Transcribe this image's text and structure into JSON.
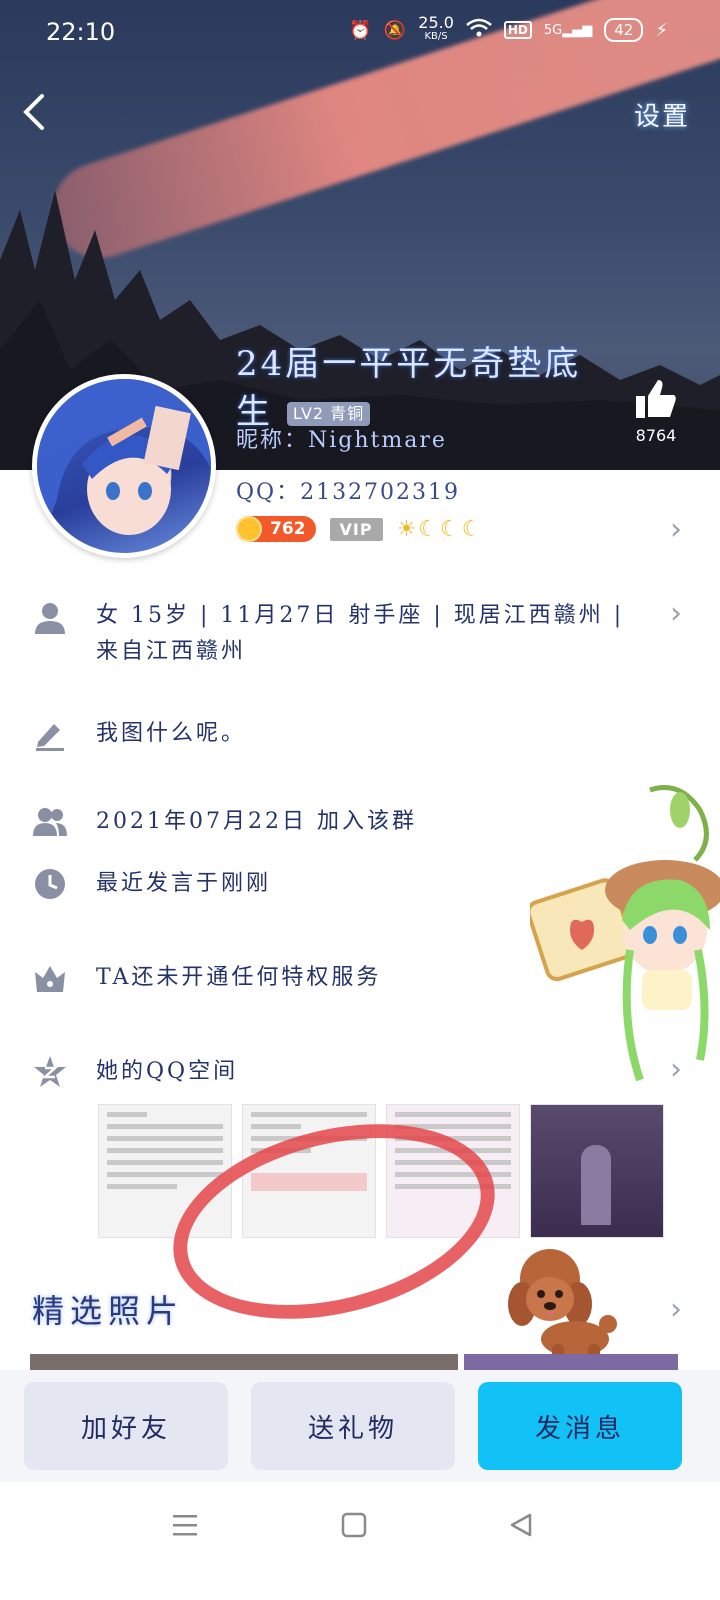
{
  "status_bar": {
    "time": "22:10",
    "net_speed": "25.0",
    "net_unit": "KB/S",
    "hd": "HD",
    "net": "5G",
    "battery": "42"
  },
  "header": {
    "settings_label": "设置",
    "name": "24届一平平无奇垫底生",
    "level": "LV2 青铜",
    "nickname": "昵称：Nightmare",
    "likes": "8764"
  },
  "profile": {
    "qq": "QQ：2132702319",
    "coins": "762",
    "vip": "VIP"
  },
  "info": {
    "basic_line1": "女 15岁 | 11月27日 射手座 | 现居江西赣州 |",
    "basic_line2": "来自江西赣州",
    "signature": "我图什么呢。",
    "joined": "2021年07月22日 加入该群",
    "last_spoke": "最近发言于刚刚",
    "privilege": "TA还未开通任何特权服务",
    "qzone": "她的QQ空间"
  },
  "featured_title": "精选照片",
  "actions": {
    "add_friend": "加好友",
    "send_gift": "送礼物",
    "send_message": "发消息"
  },
  "colors": {
    "accent": "#12c1f5",
    "coin": "#f25a2b",
    "annotation": "#e4474a"
  }
}
